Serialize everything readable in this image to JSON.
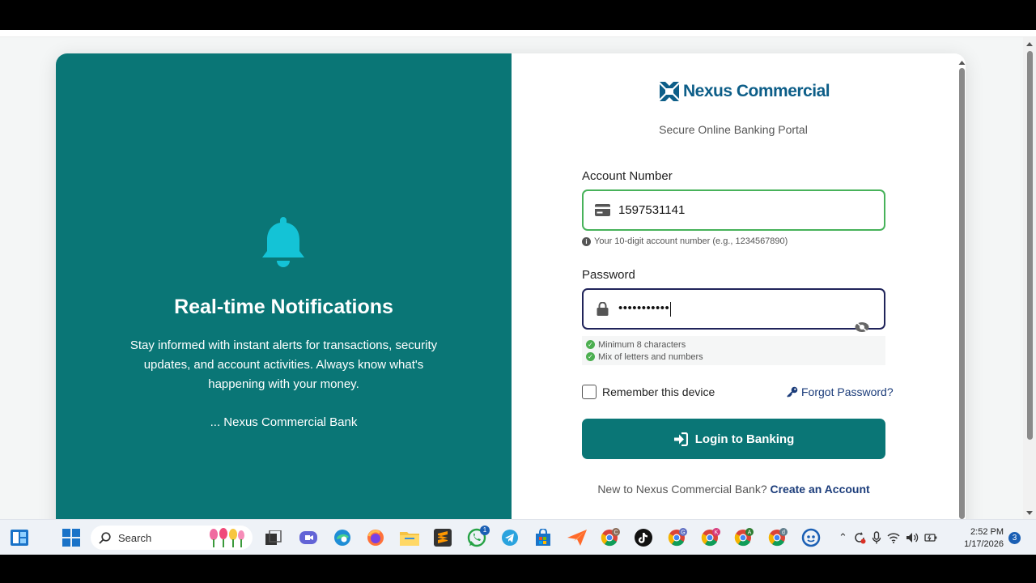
{
  "left_panel": {
    "icon": "bell-icon",
    "title": "Real-time Notifications",
    "description": "Stay informed with instant alerts for transactions, security updates, and account activities. Always know what's happening with your money.",
    "signature": "... Nexus Commercial Bank"
  },
  "right_panel": {
    "logo_text": "Nexus Commercial",
    "subtitle": "Secure Online Banking Portal",
    "account": {
      "label": "Account Number",
      "value": "1597531141",
      "hint": "Your 10-digit account number (e.g., 1234567890)"
    },
    "password": {
      "label": "Password",
      "value": "•••••••••••",
      "requirements": [
        "Minimum 8 characters",
        "Mix of letters and numbers"
      ]
    },
    "remember_label": "Remember this device",
    "forgot_label": "Forgot Password?",
    "login_label": "Login to Banking",
    "signup_prompt": "New to Nexus Commercial Bank?",
    "signup_link": "Create an Account"
  },
  "taskbar": {
    "search_placeholder": "Search",
    "whatsapp_badge": "1",
    "time": "2:52 PM",
    "date": "1/17/2026",
    "notifications": "3"
  },
  "colors": {
    "teal": "#0a7676",
    "navy": "#1b3c7a",
    "success": "#47b25a"
  }
}
